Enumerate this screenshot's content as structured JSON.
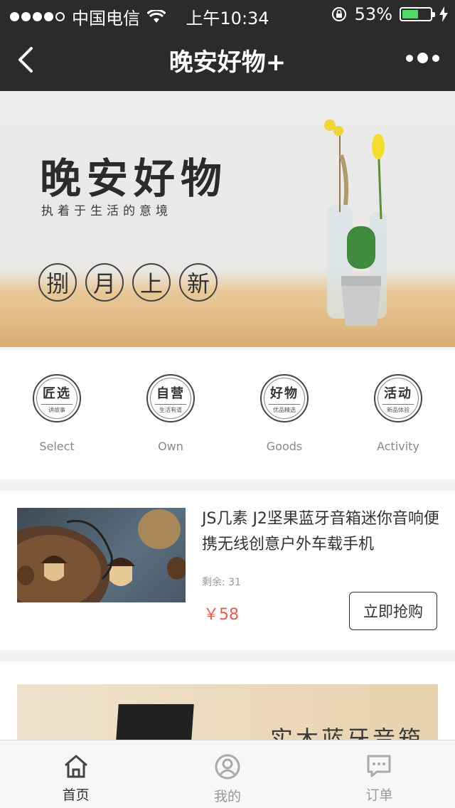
{
  "status_bar": {
    "carrier": "中国电信",
    "time": "上午10:34",
    "battery": "53%",
    "battery_level": 0.53
  },
  "nav": {
    "title": "晚安好物+",
    "back_icon": "chevron-left-icon",
    "more_icon": "more-dots-icon"
  },
  "banner": {
    "title": "晚安好物",
    "subtitle": "执着于生活的意境",
    "stamps": [
      "捌",
      "月",
      "上",
      "新"
    ]
  },
  "categories": [
    {
      "title": "匠选",
      "sub": "讲故事",
      "label": "Select"
    },
    {
      "title": "自营",
      "sub": "生活有道",
      "label": "Own"
    },
    {
      "title": "好物",
      "sub": "优品精选",
      "label": "Goods"
    },
    {
      "title": "活动",
      "sub": "新品体验",
      "label": "Activity"
    }
  ],
  "products": [
    {
      "name": "JS几素 J2坚果蓝牙音箱迷你音响便携无线创意户外车载手机",
      "remain": "剩余: 31",
      "price": "￥58",
      "buy_label": "立即抢购"
    },
    {
      "banner_text": "实木蓝牙音箱"
    }
  ],
  "tabbar": [
    {
      "label": "首页",
      "icon": "home-icon",
      "active": true
    },
    {
      "label": "我的",
      "icon": "user-icon",
      "active": false
    },
    {
      "label": "订单",
      "icon": "message-icon",
      "active": false
    }
  ],
  "colors": {
    "header_bg": "#2b2b2b",
    "price": "#e95a4f",
    "battery": "#4cd964"
  }
}
